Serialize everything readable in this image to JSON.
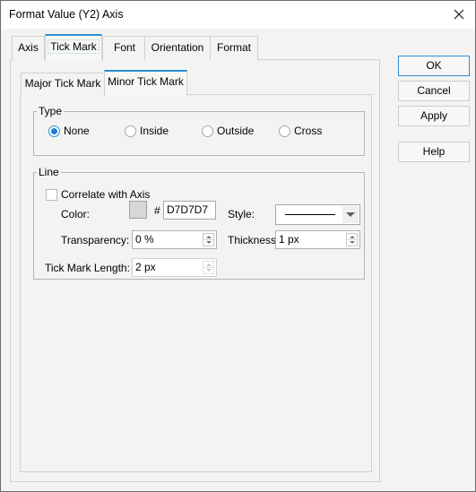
{
  "window": {
    "title": "Format Value (Y2) Axis",
    "close_icon": "close-icon"
  },
  "tabs": [
    {
      "label": "Axis",
      "active": false
    },
    {
      "label": "Tick Mark",
      "active": true
    },
    {
      "label": "Font",
      "active": false
    },
    {
      "label": "Orientation",
      "active": false
    },
    {
      "label": "Format",
      "active": false
    }
  ],
  "subtabs": [
    {
      "label": "Major Tick Mark",
      "active": false
    },
    {
      "label": "Minor Tick Mark",
      "active": true
    }
  ],
  "type_group": {
    "label": "Type",
    "options": [
      {
        "label": "None",
        "selected": true
      },
      {
        "label": "Inside",
        "selected": false
      },
      {
        "label": "Outside",
        "selected": false
      },
      {
        "label": "Cross",
        "selected": false
      }
    ]
  },
  "line_group": {
    "label": "Line",
    "correlate_label": "Correlate with Axis",
    "correlate_checked": false,
    "color_label": "Color:",
    "color_hash": "#",
    "color_value": "D7D7D7",
    "color_swatch": "#d7d7d7",
    "style_label": "Style:",
    "style_value": "solid",
    "transparency_label": "Transparency:",
    "transparency_value": "0 %",
    "thickness_label": "Thickness:",
    "thickness_value": "1 px",
    "tick_length_label": "Tick Mark Length:",
    "tick_length_value": "2 px"
  },
  "buttons": {
    "ok": "OK",
    "cancel": "Cancel",
    "apply": "Apply",
    "help": "Help"
  },
  "colors": {
    "accent": "#2a8fd1",
    "background": "#f3f4f1"
  }
}
